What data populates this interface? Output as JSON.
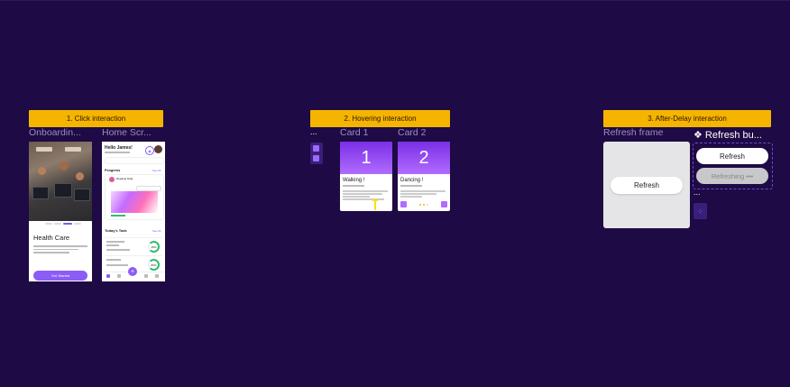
{
  "sections": [
    {
      "label": "1. Click interaction"
    },
    {
      "label": "2. Hovering interaction"
    },
    {
      "label": "3. After-Delay interaction"
    }
  ],
  "frames": {
    "onboarding": {
      "title": "Onboardin...",
      "headline": "Health Care",
      "cta": "Get Started"
    },
    "home": {
      "title": "Home Scr...",
      "greeting": "Hello James!",
      "progress_heading": "Progress",
      "see_all": "See All",
      "progress_card_title": "Reading Daily",
      "tasks_heading": "Today's Task",
      "task1_pct": "45%",
      "task2_pct": "80%"
    },
    "hover": {
      "ellipsis": "...",
      "card1_title": "Card 1",
      "card2_title": "Card 2",
      "card1_number": "1",
      "card2_number": "2",
      "card1_heading": "Walking !",
      "card2_heading": "Dancing !"
    },
    "delay": {
      "frame_title": "Refresh frame",
      "component_title": "❖ Refresh bu...",
      "refresh_label": "Refresh",
      "variant_default": "Refresh",
      "variant_loading": "Refreshing •••",
      "ellipsis": "..."
    }
  },
  "colors": {
    "background": "#1e0a44",
    "section_label": "#f5b400",
    "accent_purple": "#8b5cf6"
  }
}
